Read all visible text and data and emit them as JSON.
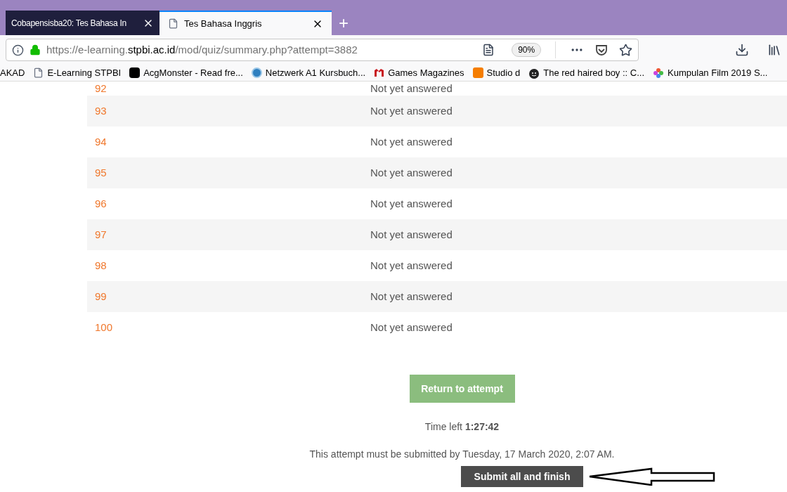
{
  "tabs": [
    {
      "title": "Cobapensisba20: Tes Bahasa In",
      "selected": false
    },
    {
      "title": "Tes Bahasa Inggris",
      "selected": true
    }
  ],
  "new_tab": "+",
  "address_bar": {
    "url_prefix": "https://e-learning.",
    "url_domain": "stpbi.ac.id",
    "url_path": "/mod/quiz/summary.php?attempt=3882",
    "zoom": "90%"
  },
  "bookmarks": [
    {
      "label": "AKAD",
      "kind": "none"
    },
    {
      "label": "E-Learning STPBI",
      "kind": "page"
    },
    {
      "label": "AcgMonster - Read fre...",
      "kind": "dark"
    },
    {
      "label": "Netzwerk A1 Kursbuch...",
      "kind": "globe"
    },
    {
      "label": "Games Magazines",
      "kind": "m"
    },
    {
      "label": "Studio d",
      "kind": "blog"
    },
    {
      "label": "The red haired boy :: C...",
      "kind": "face"
    },
    {
      "label": "Kumpulan Film 2019 S...",
      "kind": "flower"
    }
  ],
  "questions": [
    {
      "number": "92",
      "status": "Not yet answered"
    },
    {
      "number": "93",
      "status": "Not yet answered"
    },
    {
      "number": "94",
      "status": "Not yet answered"
    },
    {
      "number": "95",
      "status": "Not yet answered"
    },
    {
      "number": "96",
      "status": "Not yet answered"
    },
    {
      "number": "97",
      "status": "Not yet answered"
    },
    {
      "number": "98",
      "status": "Not yet answered"
    },
    {
      "number": "99",
      "status": "Not yet answered"
    },
    {
      "number": "100",
      "status": "Not yet answered"
    }
  ],
  "return_button": "Return to attempt",
  "time_left": {
    "label": "Time left",
    "value": "1:27:42"
  },
  "deadline_note": "This attempt must be submitted by Tuesday, 17 March 2020, 2:07 AM.",
  "submit_button": "Submit all and finish"
}
